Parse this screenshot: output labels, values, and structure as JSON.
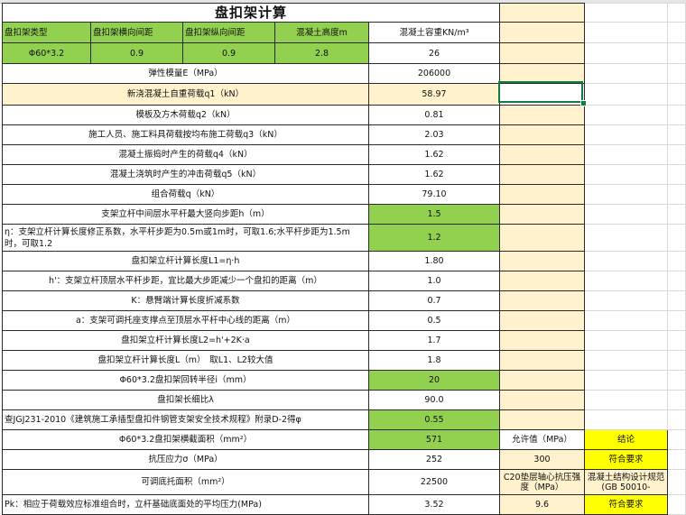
{
  "title": "盘扣架计算",
  "header": {
    "type": "盘扣架类型",
    "h_spacing": "盘扣架横向间距",
    "v_spacing": "盘扣架纵向间距",
    "thickness": "混凝土高度m",
    "density": "混凝土容重KN/m³"
  },
  "header_values": {
    "type": "Φ60*3.2",
    "h_spacing": "0.9",
    "v_spacing": "0.9",
    "thickness": "2.8",
    "density": "26"
  },
  "rows": [
    {
      "label": "弹性模量E（MPa）",
      "value": "206000"
    },
    {
      "label": "新浇混凝土自重荷载q1（kN）",
      "value": "58.97"
    },
    {
      "label": "模板及方木荷载q2（kN）",
      "value": "0.81"
    },
    {
      "label": "施工人员、施工料具荷载按均布施工荷载q3（kN）",
      "value": "2.03"
    },
    {
      "label": "混凝土振捣时产生的荷载q4（kN）",
      "value": "1.62"
    },
    {
      "label": "混凝土浇筑时产生的冲击荷载q5（kN）",
      "value": "1.62"
    },
    {
      "label": "组合荷载q（kN）",
      "value": "79.10"
    },
    {
      "label": "支架立杆中间层水平杆最大竖向步距h（m）",
      "value": "1.5"
    },
    {
      "label": "η：支架立杆计算长度修正系数，水平杆步距为0.5m或1m时，可取1.6;水平杆步距为1.5m时，可取1.2",
      "value": "1.2"
    },
    {
      "label": "盘扣架立杆计算长度L1=η·h",
      "value": "1.80"
    },
    {
      "label": "h'：支架立杆顶层水平杆步距，宜比最大步距减少一个盘扣的距离（m）",
      "value": "1.0"
    },
    {
      "label": "K：悬臂端计算长度折减系数",
      "value": "0.7"
    },
    {
      "label": "a：支架可调托座支撑点至顶层水平杆中心线的距离（m）",
      "value": "0.5"
    },
    {
      "label": "盘扣架立杆计算长度L2=h'+2K·a",
      "value": "1.7"
    },
    {
      "label": "盘扣架立杆计算长度L（m）　取L1、L2较大值",
      "value": "1.8"
    },
    {
      "label": "Φ60*3.2盘扣架回转半径i（mm）",
      "value": "20"
    },
    {
      "label": "盘扣架长细比λ",
      "value": "90.0"
    },
    {
      "label": "查JGJ231-2010《建筑施工承插型盘扣件钢管支架安全技术规程》附录D-2得φ",
      "value": "0.55"
    },
    {
      "label": "Φ60*3.2盘扣架横截面积（mm²）",
      "value": "571"
    },
    {
      "label": "抗压应力σ（MPa）",
      "value": "252"
    },
    {
      "label": "可调底托面积（mm²）",
      "value": "22500"
    },
    {
      "label": "Pk：相应于荷载效应标准组合时，立杆基础底面处的平均压力(MPa)",
      "value": "3.52"
    }
  ],
  "check": {
    "allow_header": "允许值（MPa）",
    "conclusion_header": "结论",
    "allow_1": "300",
    "conclusion_1": "符合要求",
    "label_c20": "C20垫层轴心抗压强度（MPa）",
    "label_gb": "混凝土结构设计规范(GB 50010-",
    "allow_2": "9.6",
    "conclusion_2": "符合要求"
  },
  "colors": {
    "green": "#92d050",
    "cream": "#fff2cc",
    "yellow": "#ffff00",
    "selection": "#107c41"
  }
}
